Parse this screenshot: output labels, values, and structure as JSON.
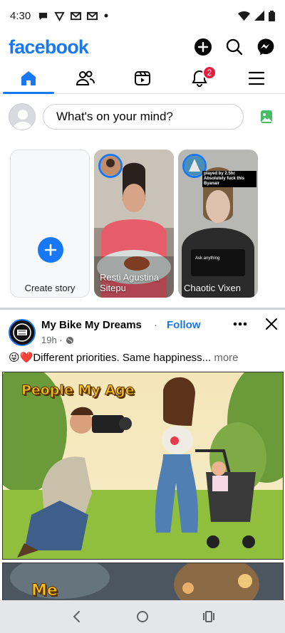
{
  "status_bar": {
    "time": "4:30"
  },
  "header": {
    "logo": "facebook"
  },
  "nav": {
    "notifications_badge": "2"
  },
  "composer": {
    "placeholder": "What's on your mind?"
  },
  "stories": {
    "create_label": "Create story",
    "items": [
      {
        "name": "Resti Agustina Sitepu"
      },
      {
        "name": "Chaotic Vixen",
        "overlay_text": "played by 2.5hr Absolutely fuck this Byanair",
        "sticker": "Ask anything"
      }
    ]
  },
  "post": {
    "author": "My Bike My Dreams",
    "separator": "·",
    "follow_label": "Follow",
    "time": "19h ·",
    "text": "😜❤️Different priorities. Same happiness...",
    "more_label": "more",
    "image_caption": "People My Age",
    "next_image_caption": "Me"
  },
  "colors": {
    "brand": "#1877f2",
    "badge": "#e41e3f",
    "photo_icon": "#45bd62"
  }
}
